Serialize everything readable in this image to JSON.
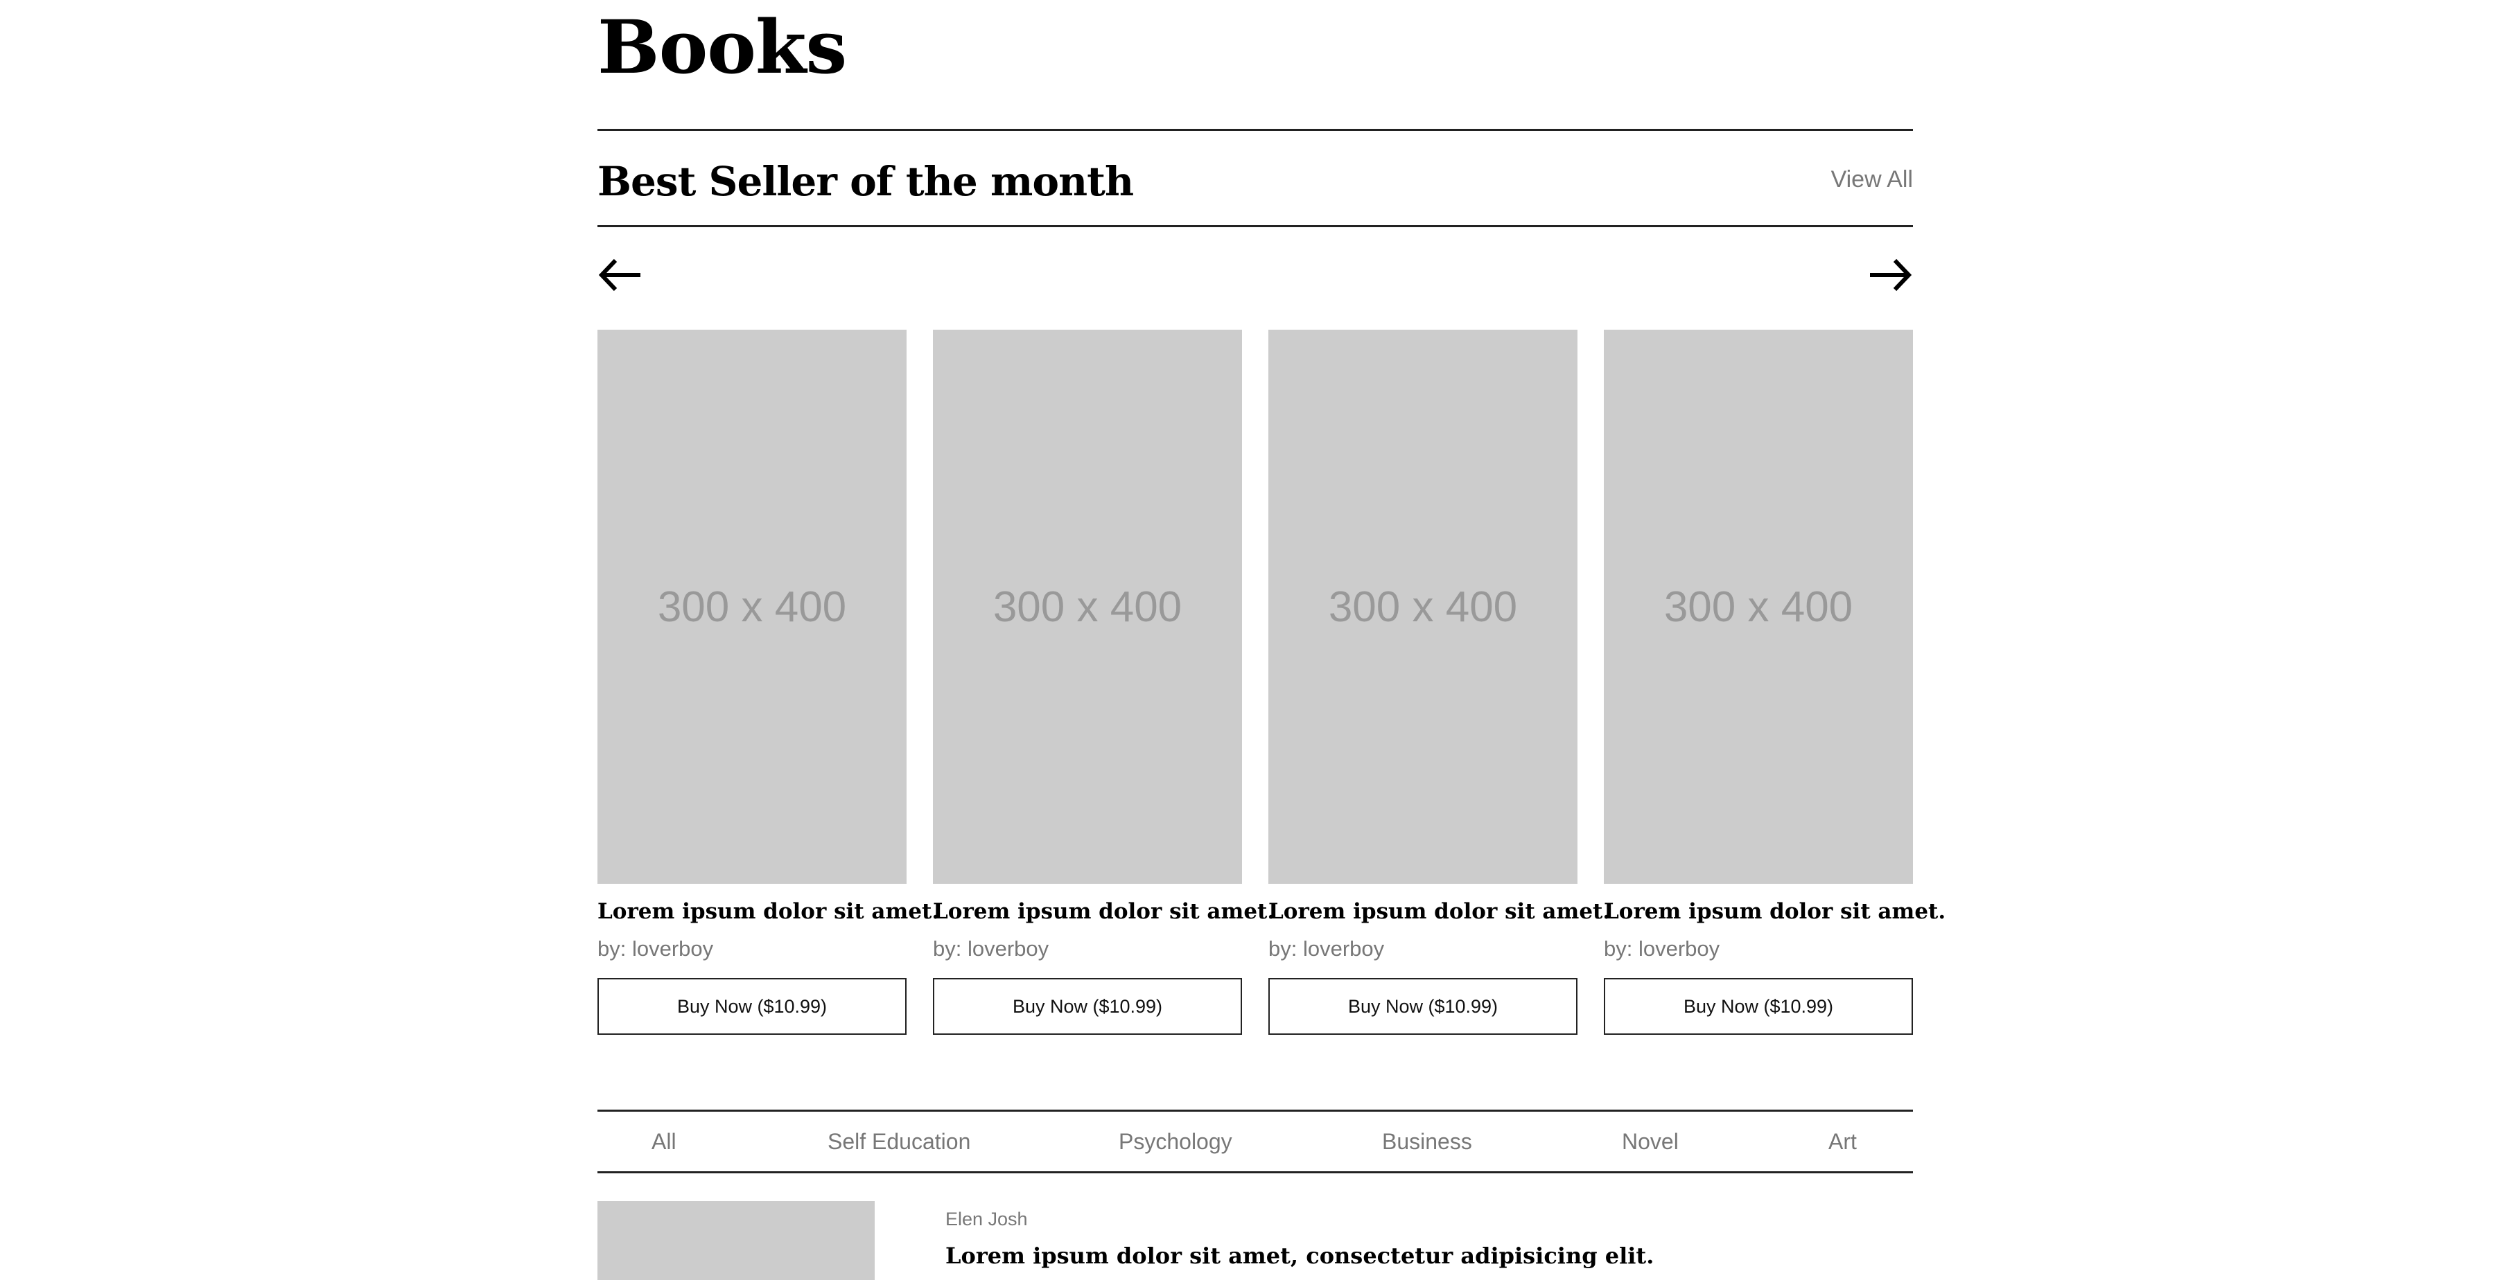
{
  "site": {
    "title": "Books"
  },
  "bestseller": {
    "title": "Best Seller of the month",
    "view_all": "View All",
    "prev_icon": "arrow-left-icon",
    "next_icon": "arrow-right-icon",
    "books": [
      {
        "image_label": "300 x 400",
        "title": "Lorem ipsum dolor sit amet.",
        "author": "by: loverboy",
        "button": "Buy Now ($10.99)"
      },
      {
        "image_label": "300 x 400",
        "title": "Lorem ipsum dolor sit amet.",
        "author": "by: loverboy",
        "button": "Buy Now ($10.99)"
      },
      {
        "image_label": "300 x 400",
        "title": "Lorem ipsum dolor sit amet.",
        "author": "by: loverboy",
        "button": "Buy Now ($10.99)"
      },
      {
        "image_label": "300 x 400",
        "title": "Lorem ipsum dolor sit amet.",
        "author": "by: loverboy",
        "button": "Buy Now ($10.99)"
      }
    ]
  },
  "categories": [
    "All",
    "Self Education",
    "Psychology",
    "Business",
    "Novel",
    "Art"
  ],
  "list": {
    "items": [
      {
        "author": "Elen Josh",
        "title": "Lorem ipsum dolor sit amet, consectetur adipisicing elit."
      }
    ]
  },
  "colors": {
    "placeholder_bg": "#cccccc",
    "muted_text": "#777777",
    "rule": "#222222"
  }
}
